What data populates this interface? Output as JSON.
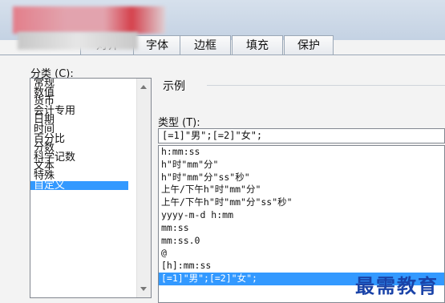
{
  "tabs": [
    {
      "label": "对齐"
    },
    {
      "label": "字体"
    },
    {
      "label": "边框"
    },
    {
      "label": "填充"
    },
    {
      "label": "保护"
    }
  ],
  "category": {
    "label": "分类 (C):",
    "items": [
      "常规",
      "数值",
      "货币",
      "会计专用",
      "日期",
      "时间",
      "百分比",
      "分数",
      "科学记数",
      "文本",
      "特殊",
      "自定义"
    ],
    "selected": "自定义"
  },
  "sample": {
    "label": "示例"
  },
  "type_field": {
    "label": "类型 (T):",
    "value": "[=1]\"男\";[=2]\"女\";"
  },
  "format_list": [
    "h:mm:ss",
    "h\"时\"mm\"分\"",
    "h\"时\"mm\"分\"ss\"秒\"",
    "上午/下午h\"时\"mm\"分\"",
    "上午/下午h\"时\"mm\"分\"ss\"秒\"",
    "yyyy-m-d h:mm",
    "mm:ss",
    "mm:ss.0",
    "@",
    "[h]:mm:ss",
    "[=1]\"男\";[=2]\"女\";"
  ],
  "selected_format_index": 10,
  "watermark": "最需教育",
  "colors": {
    "selection": "#3399ff",
    "watermark": "#1a43a8"
  }
}
